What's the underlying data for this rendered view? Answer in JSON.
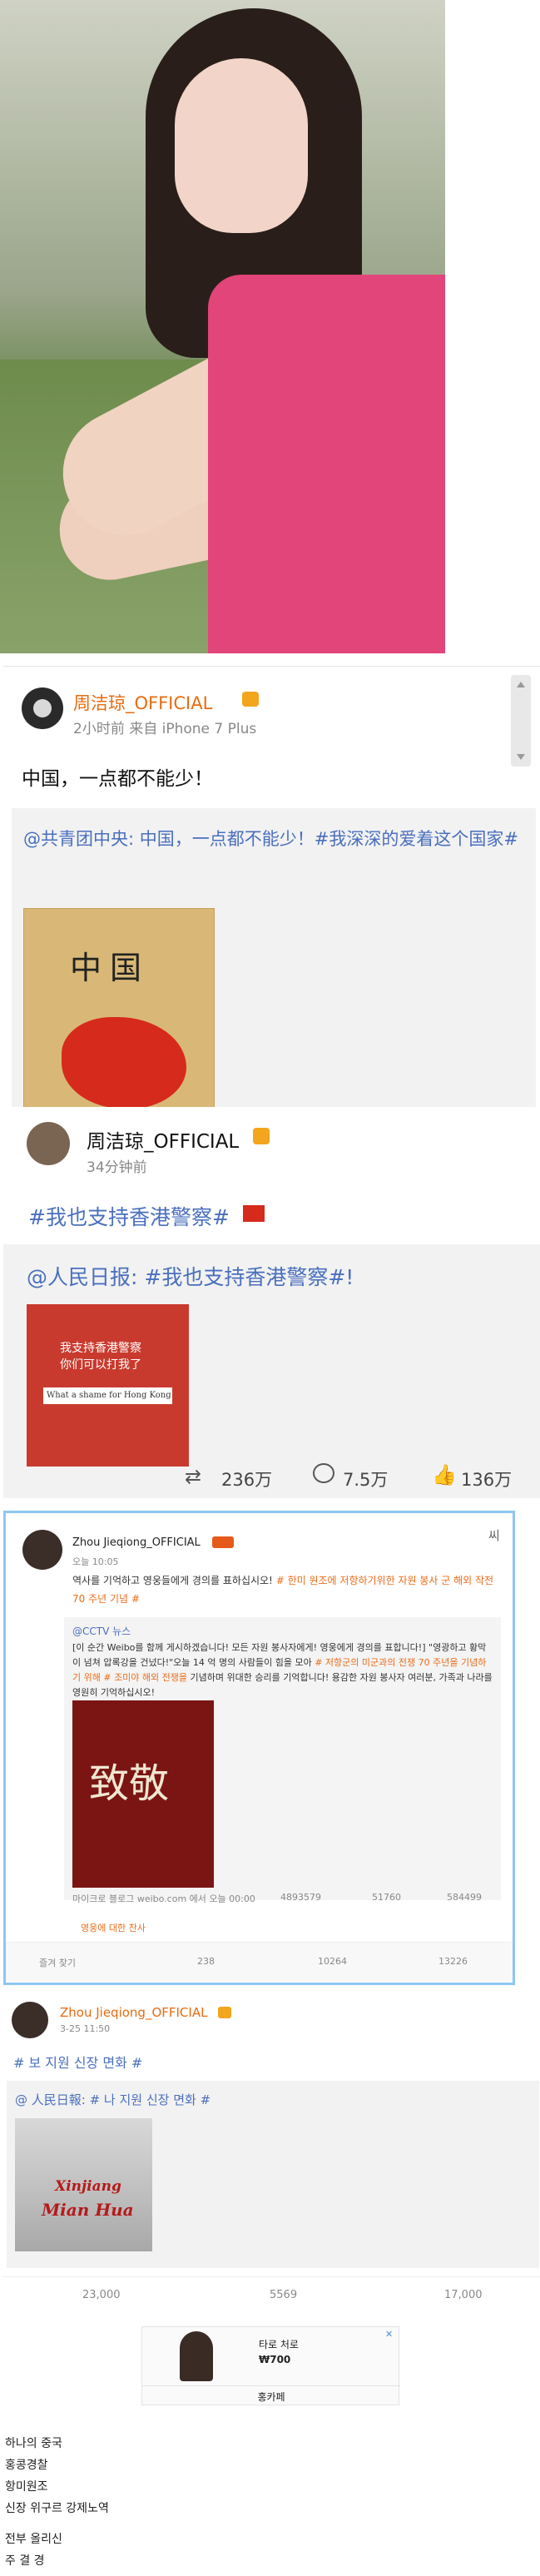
{
  "post1": {
    "name": "周洁琼_OFFICIAL",
    "meta": "2小时前 来自 iPhone 7 Plus",
    "text": "中国，一点都不能少！",
    "quote_text": "@共青团中央: 中国，一点都不能少！#我深深的爱着这个国家#",
    "quote_tag_hidden": "",
    "image_title": "中国"
  },
  "post2": {
    "name": "周洁琼_OFFICIAL",
    "meta": "34分钟前",
    "text": "#我也支持香港警察#",
    "quote_text": "@人民日报: #我也支持香港警察#!",
    "image_line1": "我支持香港警察",
    "image_line2": "你们可以打我了",
    "image_line3": "What a shame for Hong Kong",
    "repost": "236万",
    "comment": "7.5万",
    "like": "136万"
  },
  "post3": {
    "name": "Zhou Jieqiong_OFFICIAL",
    "time": "오늘 10:05",
    "corner": "씨",
    "text1": "역사를 기억하고 영웅들에게 경의를 표하십시오!",
    "text1_orange": "# 한미 원조에 저항하기위한 자원 봉사 군 해외 작전 70 주년 기념 #",
    "quote_head": "@CCTV 뉴스",
    "quote_body1": "[이 순간 Weibo를 함께 게시하겠습니다! 모든 자원 봉사자에게! 영웅에게 경의를 표합니다!]",
    "quote_body2": "\"영광하고 황막이 넘쳐 압록강을 건넜다!\"오늘 14 억 명의 사람들이 힘을 모아",
    "quote_body2_orange": "# 저항군의 미군과의 전쟁 70 주년을 기념하기 위해 # 조미야 해외 전쟁을",
    "quote_body3": "기념하며 위대한 승리를 기억합니다! 용감한 자원 봉사자 여러분, 가족과 나라를 영원히 기억하십시오!",
    "poster_text": "致敬",
    "inner_source": "마이크로 블로그 weibo.com 에서 오늘 00:00",
    "inner_repost": "4893579",
    "inner_comment": "51760",
    "inner_like": "584499",
    "translate": "영웅에 대한 찬사",
    "fav": "즐겨 찾기",
    "repost": "238",
    "comment": "10264",
    "like": "13226"
  },
  "post4": {
    "name": "Zhou Jieqiong_OFFICIAL",
    "time": "3-25 11:50",
    "text": "# 보 지원 신장 면화 #",
    "quote_text": "@ 人民日報: # 나 지원 신장 면화 #",
    "image_line1": "Xinjiang",
    "image_line2": "Mian Hua",
    "repost": "23,000",
    "comment": "5569",
    "like": "17,000"
  },
  "ad": {
    "title": "타로 처로",
    "price": "₩700",
    "brand": "홍카페"
  },
  "footer": {
    "lines": [
      "하나의 중국",
      "홍콩경찰",
      "항미원조",
      "신장 위구르 강제노역"
    ],
    "lines2": [
      "전부 올리신",
      "주 결 경"
    ]
  },
  "colors": {
    "weibo_orange": "#e86b0f",
    "link_blue": "#4a6fbe",
    "frame_blue": "#8ec6f2"
  }
}
